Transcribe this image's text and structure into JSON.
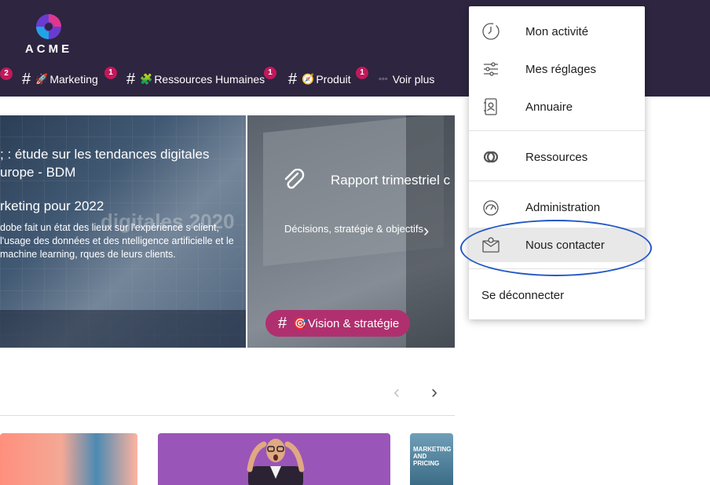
{
  "brand": {
    "name": "ACME"
  },
  "nav": {
    "items": [
      {
        "label": "Marketing",
        "emoji": "🚀",
        "badge": "1"
      },
      {
        "label": "Ressources Humaines",
        "emoji": "🧩",
        "badge": "1"
      },
      {
        "label": "Produit",
        "emoji": "🧭",
        "badge": "1"
      }
    ],
    "leading_badge": "2",
    "more_label": "Voir plus",
    "more_icon": "◦◦◦"
  },
  "carousel": {
    "slide1": {
      "title": "; : étude sur les tendances digitales urope - BDM",
      "subtitle": "rketing pour 2022",
      "body": "dobe fait un état des lieux sur l'expérience s client, l'usage des données et des ntelligence artificielle et le machine learning, rques de leurs clients.",
      "background_text": "digitales 2020"
    },
    "slide2": {
      "title": "Rapport trimestriel c",
      "subtitle": "Décisions, stratégie & objectifs",
      "tag": "Vision & stratégie",
      "tag_emoji": "🎯"
    }
  },
  "pager": {
    "prev": "‹",
    "next": "›"
  },
  "cards": {
    "book_text": "MARKETING AND PRICING"
  },
  "menu": {
    "items": [
      {
        "label": "Mon activité",
        "icon": "clock-icon"
      },
      {
        "label": "Mes réglages",
        "icon": "sliders-icon"
      },
      {
        "label": "Annuaire",
        "icon": "contacts-book-icon"
      },
      {
        "label": "Ressources",
        "icon": "link-rings-icon"
      },
      {
        "label": "Administration",
        "icon": "gauge-icon"
      },
      {
        "label": "Nous contacter",
        "icon": "mail-contact-icon"
      },
      {
        "label": "Se déconnecter",
        "icon": ""
      }
    ]
  },
  "colors": {
    "header_bg": "#2e2540",
    "badge": "#c2185b",
    "tag": "#b0306f",
    "annotation": "#2358c6"
  }
}
